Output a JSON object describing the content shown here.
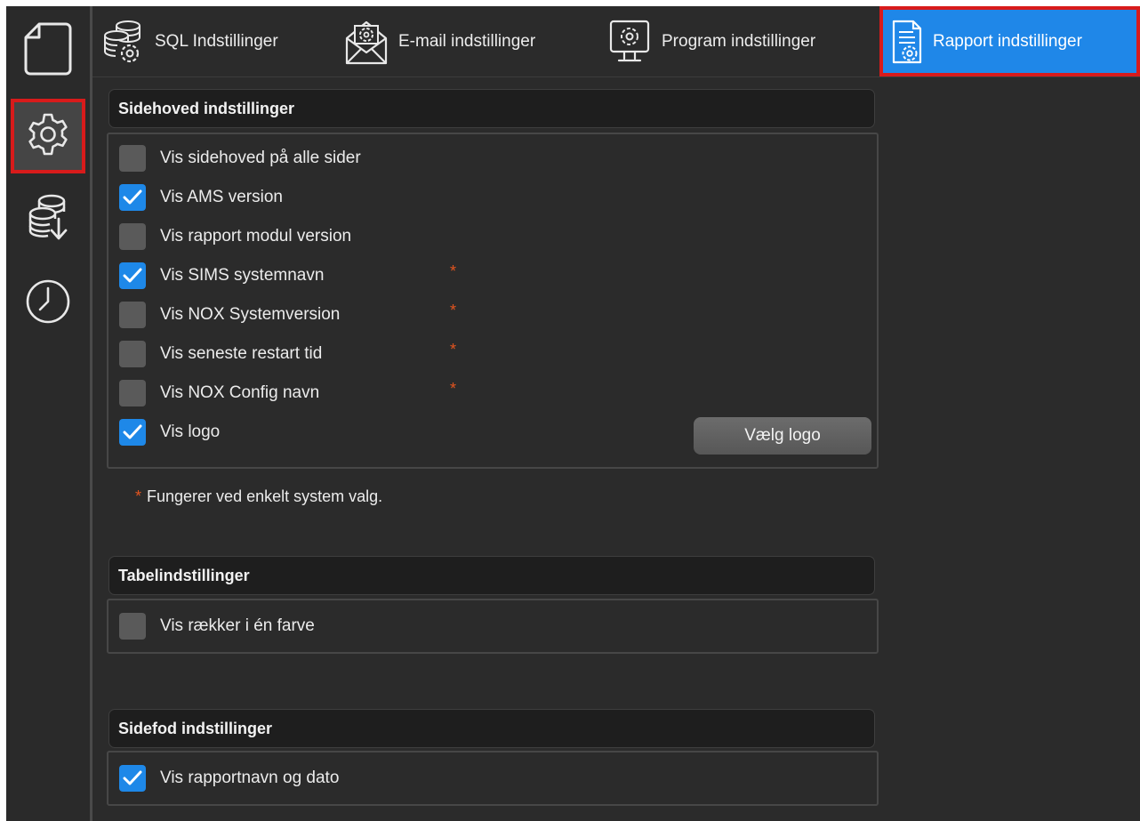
{
  "sidebar": {
    "items": [
      {
        "icon": "document-icon"
      },
      {
        "icon": "gear-icon",
        "active": true
      },
      {
        "icon": "database-download-icon"
      },
      {
        "icon": "clock-icon"
      }
    ]
  },
  "tabs": [
    {
      "label": "SQL Indstillinger",
      "icon": "database-gear-icon"
    },
    {
      "label": "E-mail indstillinger",
      "icon": "envelope-gear-icon"
    },
    {
      "label": "Program indstillinger",
      "icon": "monitor-gear-icon"
    },
    {
      "label": "Rapport indstillinger",
      "icon": "report-gear-icon",
      "active": true
    }
  ],
  "header_settings": {
    "title": "Sidehoved indstillinger",
    "options": [
      {
        "label": "Vis sidehoved på alle sider",
        "checked": false,
        "star": ""
      },
      {
        "label": "Vis AMS version",
        "checked": true,
        "star": ""
      },
      {
        "label": "Vis rapport modul version",
        "checked": false,
        "star": ""
      },
      {
        "label": "Vis SIMS systemnavn",
        "checked": true,
        "star": "*"
      },
      {
        "label": "Vis NOX Systemversion",
        "checked": false,
        "star": "*"
      },
      {
        "label": "Vis seneste restart tid",
        "checked": false,
        "star": "*"
      },
      {
        "label": "Vis NOX Config navn",
        "checked": false,
        "star": "*"
      },
      {
        "label": "Vis logo",
        "checked": true,
        "star": ""
      }
    ],
    "logo_button": "Vælg logo"
  },
  "footnote": {
    "star": "*",
    "text": "Fungerer ved enkelt system valg."
  },
  "table_settings": {
    "title": "Tabelindstillinger",
    "options": [
      {
        "label": "Vis rækker i én farve",
        "checked": false
      }
    ]
  },
  "footer_settings": {
    "title": "Sidefod indstillinger",
    "options": [
      {
        "label": "Vis rapportnavn og dato",
        "checked": true
      }
    ]
  },
  "colors": {
    "accent": "#1e88e8",
    "highlight_outline": "#d81b1b",
    "star": "#e2541f",
    "background": "#2b2b2b"
  }
}
